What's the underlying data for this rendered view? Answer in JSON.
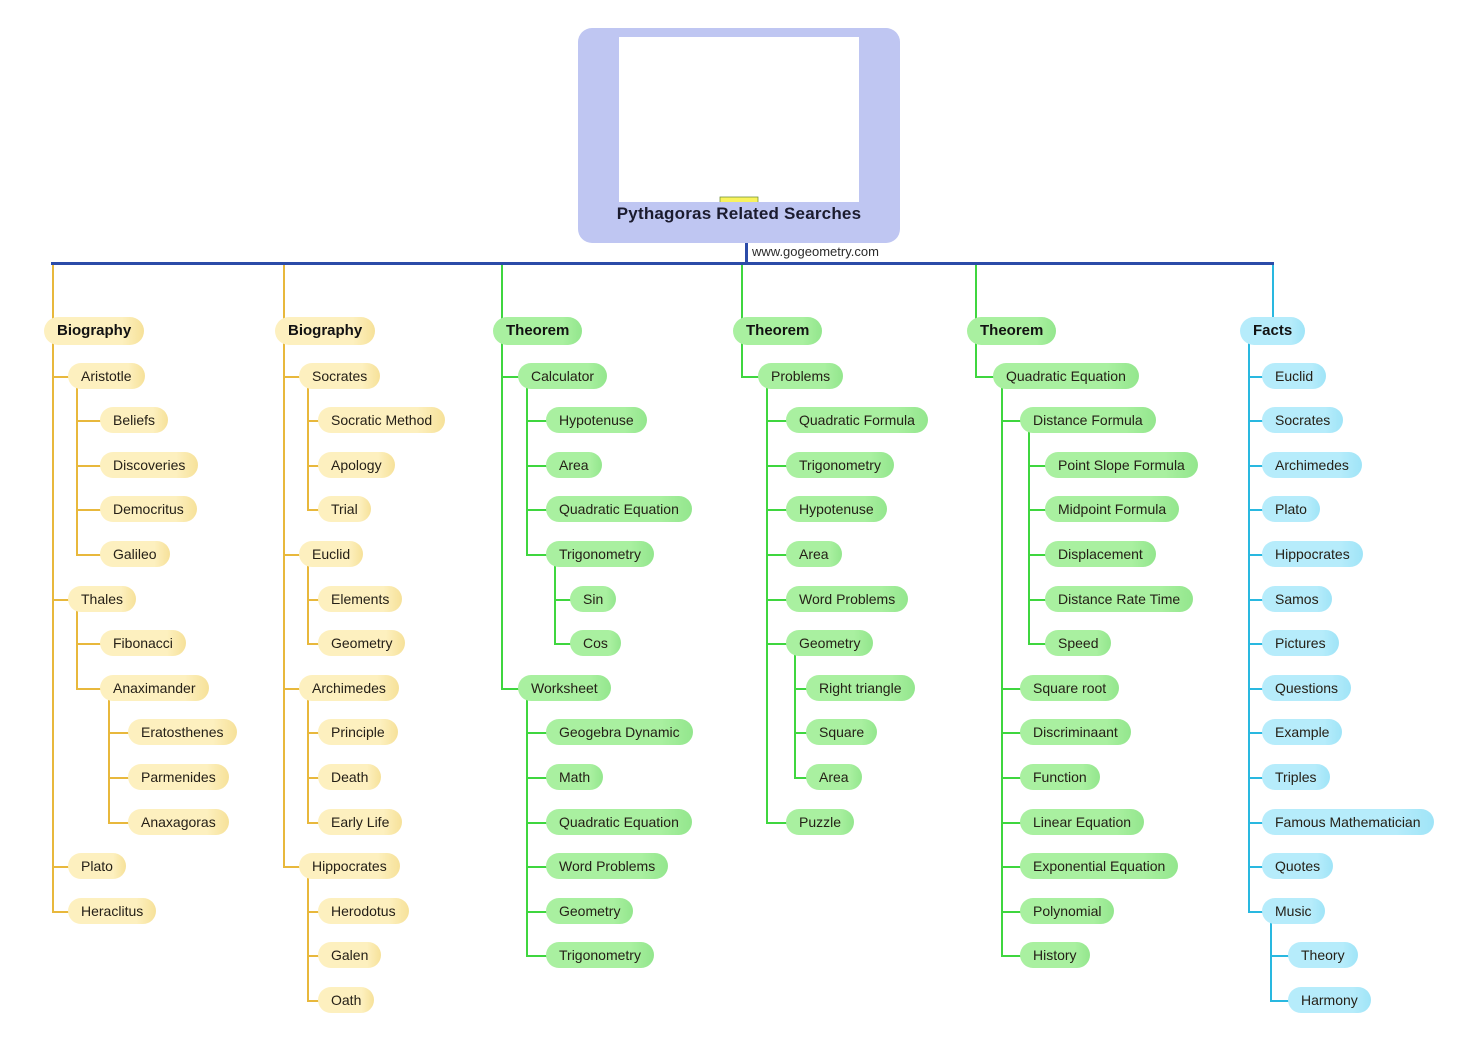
{
  "root": {
    "title": "Pythagoras Related Searches",
    "site": "www.gogeometry.com",
    "image_name": "pythagoras-tree-fractal",
    "colors": {
      "root_bg": "#bfc6f2",
      "trunk": "#2b4ba8",
      "yellow": "#fdf0bf",
      "yellow_line": "#e8b83c",
      "green": "#a9f0a0",
      "green_line": "#3fd63f",
      "cyan": "#b6ecfb",
      "cyan_line": "#29b8e0"
    }
  },
  "branches": [
    {
      "label": "Biography",
      "color": "yellow",
      "children": [
        {
          "label": "Aristotle",
          "children": [
            {
              "label": "Beliefs"
            },
            {
              "label": "Discoveries"
            },
            {
              "label": "Democritus"
            },
            {
              "label": "Galileo"
            }
          ]
        },
        {
          "label": "Thales",
          "children": [
            {
              "label": "Fibonacci"
            },
            {
              "label": "Anaximander",
              "children": [
                {
                  "label": "Eratosthenes"
                },
                {
                  "label": "Parmenides"
                },
                {
                  "label": "Anaxagoras"
                }
              ]
            }
          ]
        },
        {
          "label": "Plato"
        },
        {
          "label": "Heraclitus"
        }
      ]
    },
    {
      "label": "Biography",
      "color": "yellow",
      "children": [
        {
          "label": "Socrates",
          "children": [
            {
              "label": "Socratic Method"
            },
            {
              "label": "Apology"
            },
            {
              "label": "Trial"
            }
          ]
        },
        {
          "label": "Euclid",
          "children": [
            {
              "label": "Elements"
            },
            {
              "label": "Geometry"
            }
          ]
        },
        {
          "label": "Archimedes",
          "children": [
            {
              "label": "Principle"
            },
            {
              "label": "Death"
            },
            {
              "label": "Early Life"
            }
          ]
        },
        {
          "label": "Hippocrates",
          "children": [
            {
              "label": "Herodotus"
            },
            {
              "label": "Galen"
            },
            {
              "label": "Oath"
            }
          ]
        }
      ]
    },
    {
      "label": "Theorem",
      "color": "green",
      "children": [
        {
          "label": "Calculator",
          "children": [
            {
              "label": "Hypotenuse"
            },
            {
              "label": "Area"
            },
            {
              "label": "Quadratic Equation"
            },
            {
              "label": "Trigonometry",
              "children": [
                {
                  "label": "Sin"
                },
                {
                  "label": "Cos"
                }
              ]
            }
          ]
        },
        {
          "label": "Worksheet",
          "children": [
            {
              "label": "Geogebra Dynamic"
            },
            {
              "label": "Math"
            },
            {
              "label": "Quadratic Equation"
            },
            {
              "label": "Word Problems"
            },
            {
              "label": "Geometry"
            },
            {
              "label": "Trigonometry"
            }
          ]
        }
      ]
    },
    {
      "label": "Theorem",
      "color": "green",
      "children": [
        {
          "label": "Problems",
          "children": [
            {
              "label": "Quadratic Formula"
            },
            {
              "label": "Trigonometry"
            },
            {
              "label": "Hypotenuse"
            },
            {
              "label": "Area"
            },
            {
              "label": "Word Problems"
            },
            {
              "label": "Geometry",
              "children": [
                {
                  "label": "Right triangle"
                },
                {
                  "label": "Square"
                },
                {
                  "label": "Area"
                }
              ]
            },
            {
              "label": "Puzzle"
            }
          ]
        }
      ]
    },
    {
      "label": "Theorem",
      "color": "green",
      "children": [
        {
          "label": "Quadratic Equation",
          "children": [
            {
              "label": "Distance Formula",
              "children": [
                {
                  "label": "Point Slope Formula"
                },
                {
                  "label": "Midpoint Formula"
                },
                {
                  "label": "Displacement"
                },
                {
                  "label": "Distance Rate Time"
                },
                {
                  "label": "Speed"
                }
              ]
            },
            {
              "label": "Square root"
            },
            {
              "label": "Discriminaant"
            },
            {
              "label": "Function"
            },
            {
              "label": "Linear Equation"
            },
            {
              "label": "Exponential Equation"
            },
            {
              "label": "Polynomial"
            },
            {
              "label": "History"
            }
          ]
        }
      ]
    },
    {
      "label": "Facts",
      "color": "cyan",
      "children": [
        {
          "label": "Euclid"
        },
        {
          "label": "Socrates"
        },
        {
          "label": "Archimedes"
        },
        {
          "label": "Plato"
        },
        {
          "label": "Hippocrates"
        },
        {
          "label": "Samos"
        },
        {
          "label": "Pictures"
        },
        {
          "label": "Questions"
        },
        {
          "label": "Example"
        },
        {
          "label": "Triples"
        },
        {
          "label": "Famous Mathematician"
        },
        {
          "label": "Quotes"
        },
        {
          "label": "Music",
          "children": [
            {
              "label": "Theory"
            },
            {
              "label": "Harmony"
            }
          ]
        }
      ]
    }
  ]
}
